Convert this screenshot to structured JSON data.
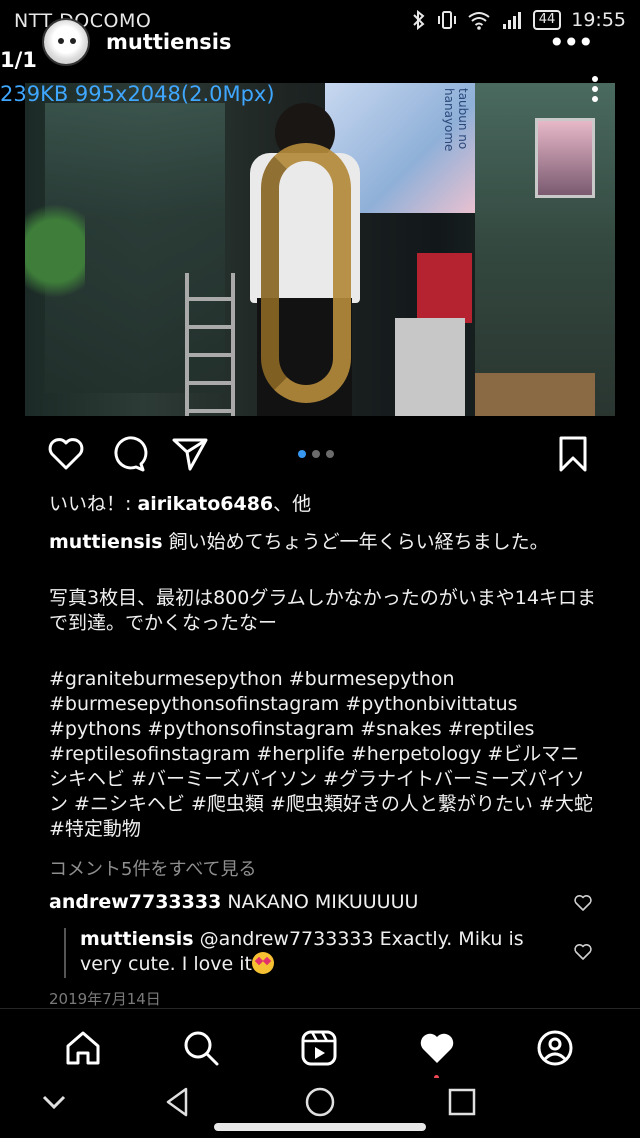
{
  "status_bar": {
    "carrier": "NTT DOCOMO",
    "battery": "44",
    "time": "19:55"
  },
  "viewer": {
    "count": "1/1",
    "info": "239KB 995x2048(2.0Mpx)"
  },
  "post": {
    "username": "muttiensis",
    "avatar_icon": "avatar-image",
    "more_icon": "more-options-icon",
    "image_label": "taubun no hanayome",
    "carousel": {
      "total": 3,
      "active": 1
    },
    "likes_prefix": "いいね！: ",
    "likes_user": "airikato6486",
    "likes_suffix": "、他",
    "caption_user": "muttiensis",
    "caption_line1": "飼い始めてちょうど一年くらい経ちました。",
    "caption_para2": "写真3枚目、最初は800グラムしかなかったのがいまや14キロまで到達。でかくなったなー",
    "hashtags": "#graniteburmesepython #burmesepython #burmesepythonsofinstagram #pythonbivittatus #pythons #pythonsofinstagram #snakes #reptiles #reptilesofinstagram #herplife #herpetology #ビルマニシキヘビ #バーミーズパイソン #グラナイトバーミーズパイソン #ニシキヘビ #爬虫類 #爬虫類好きの人と繋がりたい #大蛇 #特定動物",
    "view_comments": "コメント5件をすべて見る",
    "comment1_user": "andrew7733333",
    "comment1_text": "NAKANO MIKUUUUU",
    "reply_user": "muttiensis",
    "reply_text": "@andrew7733333 Exactly.  Miku is very cute.  I love it",
    "date": "2019年7月14日"
  },
  "colors": {
    "background": "#000000",
    "link_blue": "#3fa7ff",
    "carousel_active": "#3897f0",
    "notif_red": "#ed4956"
  }
}
